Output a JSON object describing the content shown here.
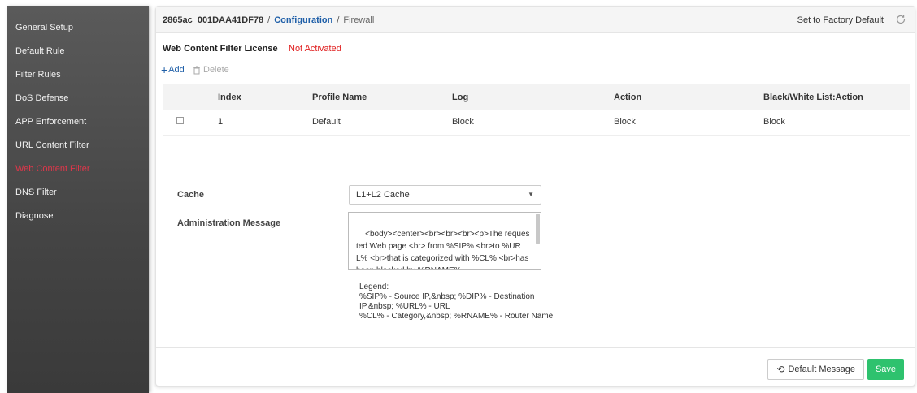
{
  "sidebar": {
    "items": [
      {
        "label": "General Setup"
      },
      {
        "label": "Default Rule"
      },
      {
        "label": "Filter Rules"
      },
      {
        "label": "DoS Defense"
      },
      {
        "label": "APP Enforcement"
      },
      {
        "label": "URL Content Filter"
      },
      {
        "label": "Web Content Filter"
      },
      {
        "label": "DNS Filter"
      },
      {
        "label": "Diagnose"
      }
    ],
    "active_color": "#e0364a"
  },
  "header": {
    "device": "2865ac_001DAA41DF78",
    "separator": "/",
    "section": "Configuration",
    "page": "Firewall",
    "factory_label": "Set to Factory Default",
    "refresh_icon": "refresh-icon"
  },
  "license": {
    "label": "Web Content Filter License",
    "status": "Not Activated",
    "status_color": "#e02020"
  },
  "toolbar": {
    "add_label": "Add",
    "delete_label": "Delete"
  },
  "table": {
    "headers": [
      "Index",
      "Profile Name",
      "Log",
      "Action",
      "Black/White List:Action"
    ],
    "rows": [
      {
        "index": "1",
        "profile": "Default",
        "log": "Block",
        "action": "Block",
        "bw_action": "Block"
      }
    ]
  },
  "form": {
    "cache_label": "Cache",
    "cache_value": "L1+L2 Cache",
    "admin_label": "Administration Message",
    "admin_message": "<body><center><br><br><br><p>The requested Web page <br> from %SIP% <br>to %URL% <br>that is categorized with %CL% <br>has been blocked by %RNAME%",
    "legend_title": "Legend:",
    "legend_text": "%SIP% - Source IP,&nbsp; %DIP% - Destination IP,&nbsp; %URL% - URL\n%CL% - Category,&nbsp; %RNAME% - Router Name"
  },
  "footer": {
    "default_label": "Default Message",
    "save_label": "Save",
    "save_color": "#2ec26e"
  }
}
